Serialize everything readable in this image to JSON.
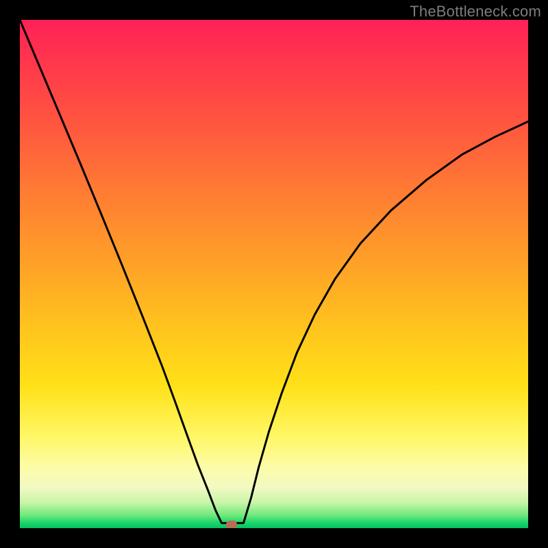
{
  "watermark": "TheBottleneck.com",
  "marker": {
    "x_frac": 0.417,
    "y_frac": 0.993
  },
  "colors": {
    "frame": "#000000",
    "curve": "#000000",
    "marker": "#bb6a53",
    "watermark": "#7d7d7d"
  },
  "chart_data": {
    "type": "line",
    "title": "",
    "xlabel": "",
    "ylabel": "",
    "xlim": [
      0,
      1
    ],
    "ylim": [
      0,
      1
    ],
    "annotations": [
      "TheBottleneck.com"
    ],
    "series": [
      {
        "name": "left-branch",
        "x": [
          0.0,
          0.04,
          0.08,
          0.12,
          0.16,
          0.2,
          0.24,
          0.28,
          0.305,
          0.33,
          0.35,
          0.37,
          0.385,
          0.397
        ],
        "y": [
          1.0,
          0.905,
          0.81,
          0.715,
          0.618,
          0.52,
          0.42,
          0.318,
          0.25,
          0.18,
          0.125,
          0.075,
          0.035,
          0.01
        ]
      },
      {
        "name": "flat-bottom",
        "x": [
          0.397,
          0.44
        ],
        "y": [
          0.01,
          0.01
        ]
      },
      {
        "name": "right-branch",
        "x": [
          0.44,
          0.455,
          0.47,
          0.49,
          0.515,
          0.545,
          0.58,
          0.62,
          0.67,
          0.73,
          0.8,
          0.87,
          0.935,
          1.0
        ],
        "y": [
          0.01,
          0.06,
          0.12,
          0.19,
          0.265,
          0.345,
          0.42,
          0.49,
          0.56,
          0.625,
          0.685,
          0.735,
          0.77,
          0.8
        ]
      }
    ],
    "gradient_stops": [
      {
        "pos": 0.0,
        "color": "#ff2157"
      },
      {
        "pos": 0.1,
        "color": "#ff3b4a"
      },
      {
        "pos": 0.22,
        "color": "#ff5a3e"
      },
      {
        "pos": 0.34,
        "color": "#ff7c33"
      },
      {
        "pos": 0.48,
        "color": "#ffa127"
      },
      {
        "pos": 0.6,
        "color": "#ffc21e"
      },
      {
        "pos": 0.72,
        "color": "#ffe118"
      },
      {
        "pos": 0.82,
        "color": "#fff765"
      },
      {
        "pos": 0.88,
        "color": "#fcfca8"
      },
      {
        "pos": 0.92,
        "color": "#f2f9c2"
      },
      {
        "pos": 0.95,
        "color": "#c8f5a7"
      },
      {
        "pos": 0.975,
        "color": "#6fe87b"
      },
      {
        "pos": 0.99,
        "color": "#17d56a"
      },
      {
        "pos": 1.0,
        "color": "#06c062"
      }
    ]
  }
}
